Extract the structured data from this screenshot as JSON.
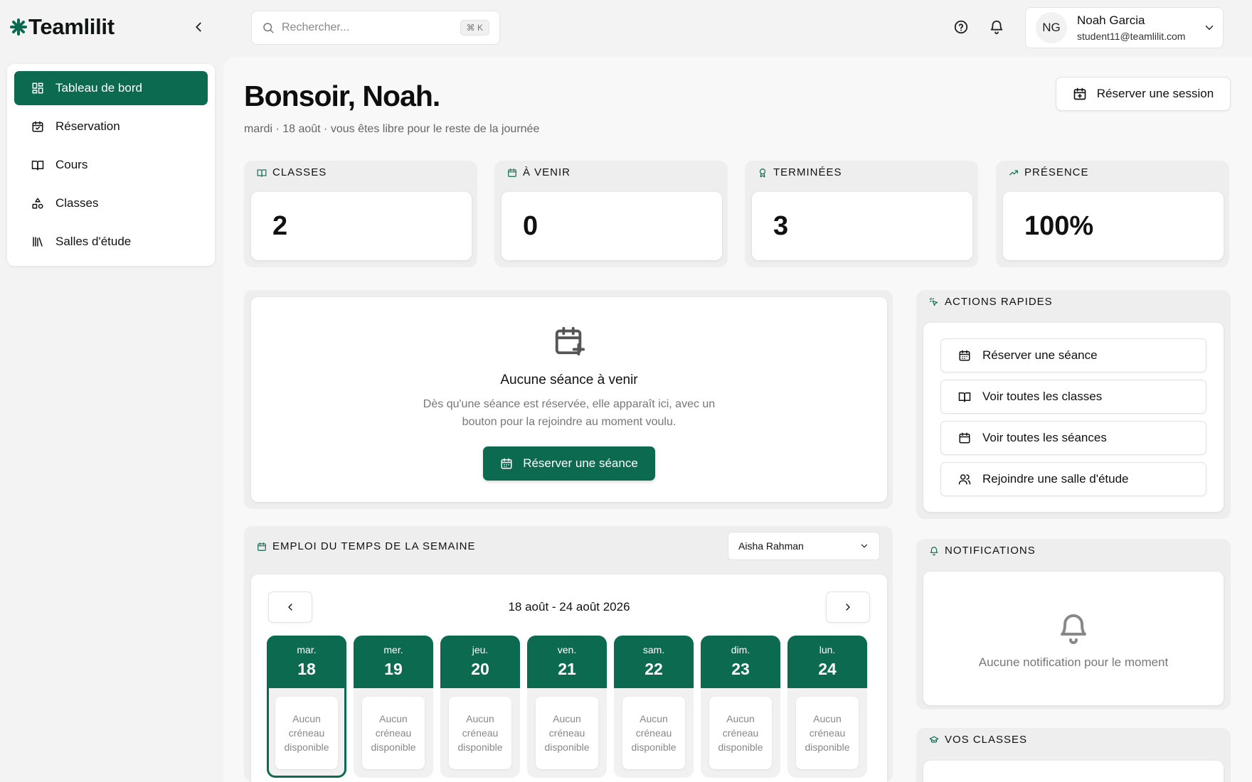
{
  "brand": {
    "name": "Teamlilit"
  },
  "search": {
    "placeholder": "Rechercher...",
    "shortcut": "⌘ K"
  },
  "user": {
    "initials": "NG",
    "name": "Noah Garcia",
    "email": "student11@teamlilit.com"
  },
  "sidebar": {
    "items": [
      {
        "label": "Tableau de bord",
        "icon": "dashboard-icon",
        "active": true
      },
      {
        "label": "Réservation",
        "icon": "calendar-check-icon",
        "active": false
      },
      {
        "label": "Cours",
        "icon": "book-icon",
        "active": false
      },
      {
        "label": "Classes",
        "icon": "shapes-icon",
        "active": false
      },
      {
        "label": "Salles d'étude",
        "icon": "library-icon",
        "active": false
      }
    ]
  },
  "header": {
    "greeting": "Bonsoir, Noah.",
    "subtitle": "mardi · 18 août · vous êtes libre pour le reste de la journée",
    "reserve_button": "Réserver une session"
  },
  "stats": [
    {
      "label": "CLASSES",
      "value": "2",
      "icon": "book-open-icon"
    },
    {
      "label": "À VENIR",
      "value": "0",
      "icon": "calendar-icon"
    },
    {
      "label": "TERMINÉES",
      "value": "3",
      "icon": "award-icon"
    },
    {
      "label": "PRÉSENCE",
      "value": "100%",
      "icon": "trending-up-icon"
    }
  ],
  "upcoming": {
    "title": "Aucune séance à venir",
    "description": "Dès qu'une séance est réservée, elle apparaît ici, avec un bouton pour la rejoindre au moment voulu.",
    "button": "Réserver une séance"
  },
  "schedule": {
    "title": "EMPLOI DU TEMPS DE LA SEMAINE",
    "tutor": "Aisha Rahman",
    "week_label": "18 août - 24 août 2026",
    "days": [
      {
        "name": "mar.",
        "num": "18",
        "slot": "Aucun créneau disponible",
        "today": true
      },
      {
        "name": "mer.",
        "num": "19",
        "slot": "Aucun créneau disponible",
        "today": false
      },
      {
        "name": "jeu.",
        "num": "20",
        "slot": "Aucun créneau disponible",
        "today": false
      },
      {
        "name": "ven.",
        "num": "21",
        "slot": "Aucun créneau disponible",
        "today": false
      },
      {
        "name": "sam.",
        "num": "22",
        "slot": "Aucun créneau disponible",
        "today": false
      },
      {
        "name": "dim.",
        "num": "23",
        "slot": "Aucun créneau disponible",
        "today": false
      },
      {
        "name": "lun.",
        "num": "24",
        "slot": "Aucun créneau disponible",
        "today": false
      }
    ]
  },
  "quick_actions": {
    "title": "ACTIONS RAPIDES",
    "items": [
      {
        "label": "Réserver une séance",
        "icon": "calendar-grid-icon"
      },
      {
        "label": "Voir toutes les classes",
        "icon": "book-open-icon"
      },
      {
        "label": "Voir toutes les séances",
        "icon": "calendar-icon"
      },
      {
        "label": "Rejoindre une salle d'étude",
        "icon": "users-icon"
      }
    ]
  },
  "notifications": {
    "title": "NOTIFICATIONS",
    "empty": "Aucune notification pour le moment"
  },
  "classes_panel": {
    "title": "VOS CLASSES"
  },
  "colors": {
    "accent": "#0b6a4f",
    "background": "#f3f3f3"
  }
}
